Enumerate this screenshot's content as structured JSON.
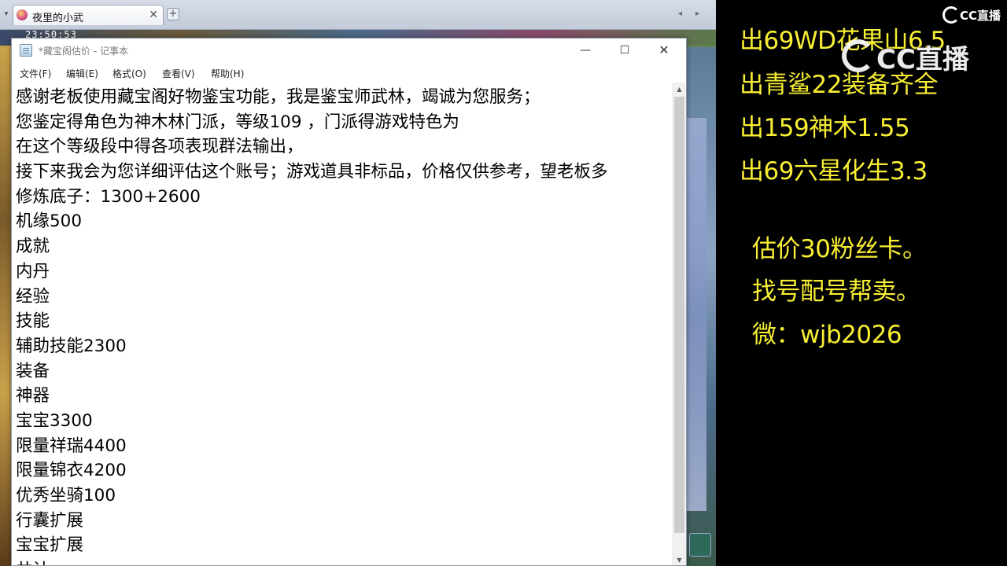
{
  "browser": {
    "tab_title": "夜里的小武",
    "tab_close": "✕",
    "new_tab": "+",
    "menu_arrow": "▾",
    "scroll_left": "◂",
    "scroll_right": "▸"
  },
  "game": {
    "clock": "23:50:53"
  },
  "notepad": {
    "title": "*藏宝阁估价 - 记事本",
    "window_buttons": {
      "minimize": "—",
      "maximize": "☐",
      "close": "✕"
    },
    "menu": [
      "文件(F)",
      "编辑(E)",
      "格式(O)",
      "查看(V)",
      "帮助(H)"
    ],
    "lines": [
      "感谢老板使用藏宝阁好物鉴宝功能，我是鉴宝师武林，竭诚为您服务；",
      "您鉴定得角色为神木林门派，等级109 ，门派得游戏特色为",
      "在这个等级段中得各项表现群法输出，",
      "接下来我会为您详细评估这个账号；游戏道具非标品，价格仅供参考，望老板多",
      "修炼底子：1300+2600",
      "机缘500",
      "成就",
      "内丹",
      "经验",
      "技能",
      "辅助技能2300",
      "装备",
      "神器",
      "宝宝3300",
      "限量祥瑞4400",
      "限量锦衣4200",
      "优秀坐骑100",
      "行囊扩展",
      "宝宝扩展",
      "共计"
    ],
    "scroll_up": "▲",
    "scroll_down": "▼"
  },
  "overlay": {
    "logo_text": "CC直播",
    "sale_lines": [
      "出69WD花果山6.5",
      "出青鲨22装备齐全",
      "出159神木1.55",
      "出69六星化生3.3"
    ],
    "info_lines": [
      "估价30粉丝卡。",
      "找号配号帮卖。",
      "微：wjb2026"
    ],
    "text_color": "#f7ee33"
  }
}
